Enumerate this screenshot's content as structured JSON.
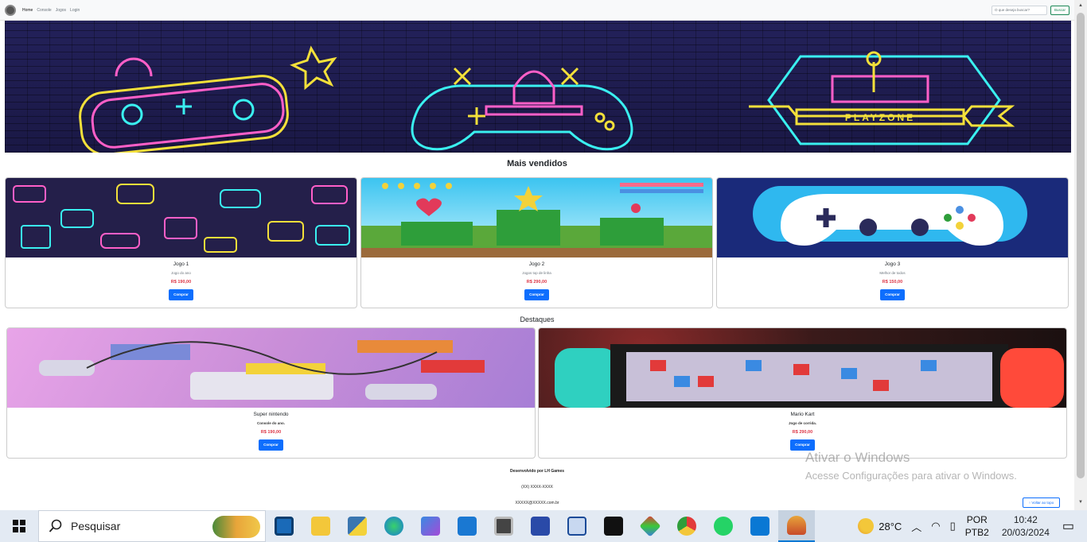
{
  "navbar": {
    "links": [
      "Home",
      "Console",
      "Jogos",
      "Login"
    ],
    "search_placeholder": "O que deseja buscar?",
    "search_button": "Buscar"
  },
  "sections": {
    "best_sellers_title": "Mais vendidos",
    "featured_title": "Destaques"
  },
  "best_sellers": [
    {
      "title": "Jogo 1",
      "subtitle": "Jogo do ano",
      "price": "R$ 190,00",
      "button": "Comprar"
    },
    {
      "title": "Jogo 2",
      "subtitle": "Jogos top de linha",
      "price": "R$ 290,00",
      "button": "Comprar"
    },
    {
      "title": "Jogo 3",
      "subtitle": "Melhor de todos",
      "price": "R$ 150,00",
      "button": "Comprar"
    }
  ],
  "featured": [
    {
      "title": "Super nintendo",
      "subtitle": "Console do ano.",
      "price": "R$ 190,00",
      "button": "Comprar"
    },
    {
      "title": "Mario Kart",
      "subtitle": "Jogo de corrida.",
      "price": "R$ 290,00",
      "button": "Comprar"
    }
  ],
  "footer": {
    "developed_by": "Desenvolvido por LH Games",
    "phone": "(XX) XXXX-XXXX",
    "email": "XXXXX@XXXXX.com.br",
    "back_to_top": "↑ Voltar ao topo"
  },
  "banner": {
    "neon_text": "PLAYZONE"
  },
  "watermark": {
    "line1": "Ativar o Windows",
    "line2": "Acesse Configurações para ativar o Windows."
  },
  "taskbar": {
    "search_text": "Pesquisar",
    "weather": "28°C",
    "lang_top": "POR",
    "lang_bottom": "PTB2",
    "time": "10:42",
    "date": "20/03/2024"
  },
  "colors": {
    "accent": "#0d6efd",
    "price": "#dc3545",
    "banner_bg": "#1d1b4a"
  }
}
